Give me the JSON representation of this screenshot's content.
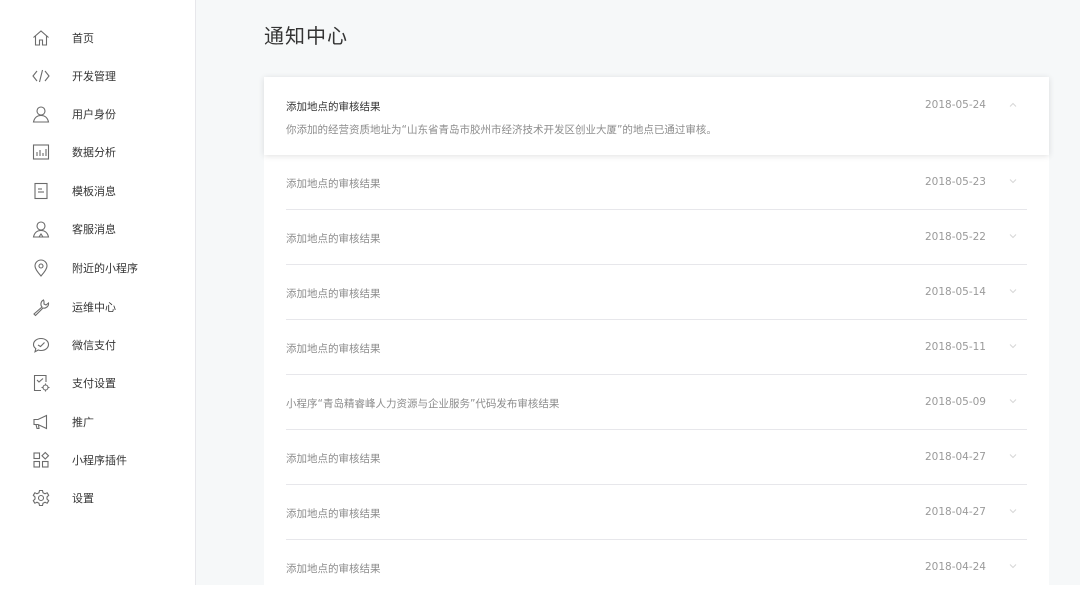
{
  "sidebar": {
    "items": [
      {
        "label": "首页",
        "icon": "home-icon"
      },
      {
        "label": "开发管理",
        "icon": "code-icon"
      },
      {
        "label": "用户身份",
        "icon": "user-icon"
      },
      {
        "label": "数据分析",
        "icon": "bar-chart-icon"
      },
      {
        "label": "模板消息",
        "icon": "document-icon"
      },
      {
        "label": "客服消息",
        "icon": "customer-service-icon"
      },
      {
        "label": "附近的小程序",
        "icon": "location-pin-icon"
      },
      {
        "label": "运维中心",
        "icon": "wrench-icon"
      },
      {
        "label": "微信支付",
        "icon": "wechat-pay-icon"
      },
      {
        "label": "支付设置",
        "icon": "payment-settings-icon"
      },
      {
        "label": "推广",
        "icon": "megaphone-icon"
      },
      {
        "label": "小程序插件",
        "icon": "plugin-icon"
      },
      {
        "label": "设置",
        "icon": "gear-icon"
      }
    ]
  },
  "main": {
    "title": "通知中心",
    "notices": [
      {
        "title": "添加地点的审核结果",
        "date": "2018-05-24",
        "expanded": true,
        "body": "你添加的经营资质地址为“山东省青岛市胶州市经济技术开发区创业大厦”的地点已通过审核。"
      },
      {
        "title": "添加地点的审核结果",
        "date": "2018-05-23",
        "expanded": false
      },
      {
        "title": "添加地点的审核结果",
        "date": "2018-05-22",
        "expanded": false
      },
      {
        "title": "添加地点的审核结果",
        "date": "2018-05-14",
        "expanded": false
      },
      {
        "title": "添加地点的审核结果",
        "date": "2018-05-11",
        "expanded": false
      },
      {
        "title": "小程序“青岛精睿峰人力资源与企业服务”代码发布审核结果",
        "date": "2018-05-09",
        "expanded": false
      },
      {
        "title": "添加地点的审核结果",
        "date": "2018-04-27",
        "expanded": false
      },
      {
        "title": "添加地点的审核结果",
        "date": "2018-04-27",
        "expanded": false
      },
      {
        "title": "添加地点的审核结果",
        "date": "2018-04-24",
        "expanded": false
      }
    ]
  },
  "colors": {
    "text": "#353535",
    "muted": "#8d8d8d",
    "date": "#9a9a9a",
    "divider": "#e7e7eb",
    "background": "#f6f8f9"
  }
}
